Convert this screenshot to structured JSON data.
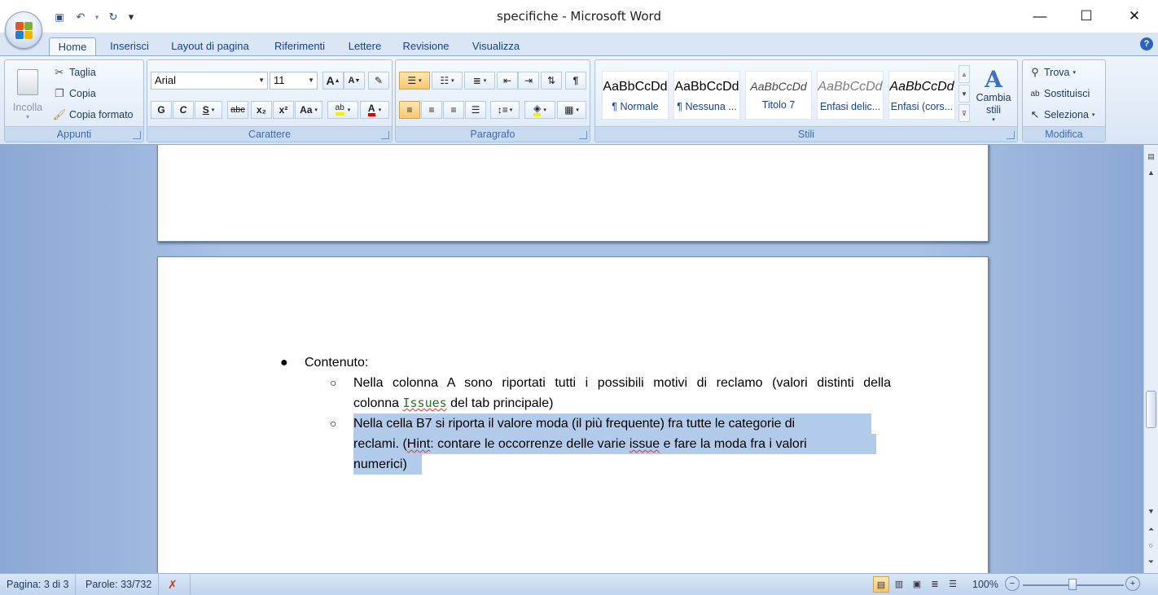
{
  "window": {
    "title": "specifiche - Microsoft Word",
    "minimize_glyph": "—",
    "maximize_glyph": "☐",
    "close_glyph": "✕"
  },
  "quick_access": {
    "save_glyph": "💾",
    "undo_glyph": "↶",
    "redo_glyph": "↻",
    "customize_glyph": "▾"
  },
  "tabs": [
    {
      "label": "Home"
    },
    {
      "label": "Inserisci"
    },
    {
      "label": "Layout di pagina"
    },
    {
      "label": "Riferimenti"
    },
    {
      "label": "Lettere"
    },
    {
      "label": "Revisione"
    },
    {
      "label": "Visualizza"
    }
  ],
  "help_glyph": "?",
  "ribbon": {
    "appunti": {
      "label": "Appunti",
      "paste": "Incolla",
      "cut": "Taglia",
      "copy": "Copia",
      "format_painter": "Copia formato"
    },
    "carattere": {
      "label": "Carattere",
      "font_name": "Arial",
      "font_size": "11",
      "bold": "G",
      "italic": "C",
      "underline": "S",
      "strike": "abc",
      "subscript": "x₂",
      "superscript": "x²",
      "change_case": "Aa",
      "grow": "A",
      "shrink": "A"
    },
    "paragrafo": {
      "label": "Paragrafo",
      "pilcrow": "¶"
    },
    "stili": {
      "label": "Stili",
      "tiles": [
        {
          "sample": "AaBbCcDd",
          "name": "¶ Normale"
        },
        {
          "sample": "AaBbCcDd",
          "name": "¶ Nessuna ..."
        },
        {
          "sample": "AaBbCcDd",
          "name": "Titolo 7"
        },
        {
          "sample": "AaBbCcDd",
          "name": "Enfasi delic..."
        },
        {
          "sample": "AaBbCcDd",
          "name": "Enfasi (cors..."
        }
      ],
      "change_styles": "Cambia stili"
    },
    "modifica": {
      "label": "Modifica",
      "find": "Trova",
      "replace": "Sostituisci",
      "select": "Seleziona"
    }
  },
  "document": {
    "heading_bullet": "Contenuto:",
    "item1_line1": "Nella colonna A sono riportati tutti i possibili motivi di reclamo (valori distinti della",
    "item1_line2_pre": "colonna ",
    "item1_code": "Issues",
    "item1_line2_post": " del tab principale)",
    "item2_line1": "Nella cella B7 si riporta il valore moda (il più frequente) fra tutte le categorie di",
    "item2_line2_a": "reclami. (",
    "item2_hint": "Hint",
    "item2_line2_b": ": contare le occorrenze delle varie ",
    "item2_issue": "issue",
    "item2_line2_c": " e fare la moda fra i valori",
    "item2_line3": "numerici)"
  },
  "status": {
    "page": "Pagina: 3 di 3",
    "words": "Parole: 33/732",
    "zoom": "100%"
  },
  "colors": {
    "selection": "#b3cbea",
    "ribbon_label": "#3e6aaa",
    "tab_text": "#15428b"
  }
}
